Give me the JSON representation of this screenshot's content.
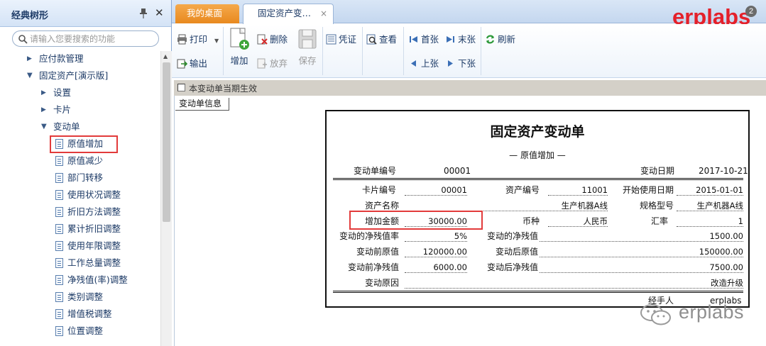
{
  "sidebar": {
    "title": "经典树形",
    "search_placeholder": "请输入您要搜索的功能",
    "items": [
      {
        "label": "应付款管理",
        "indent": 1,
        "arrow": "right"
      },
      {
        "label": "固定资产[演示版]",
        "indent": 1,
        "arrow": "down"
      },
      {
        "label": "设置",
        "indent": 2,
        "arrow": "right"
      },
      {
        "label": "卡片",
        "indent": 2,
        "arrow": "right"
      },
      {
        "label": "变动单",
        "indent": 2,
        "arrow": "down"
      },
      {
        "label": "原值增加",
        "indent": 3,
        "selected": true
      },
      {
        "label": "原值减少",
        "indent": 3
      },
      {
        "label": "部门转移",
        "indent": 3
      },
      {
        "label": "使用状况调整",
        "indent": 3
      },
      {
        "label": "折旧方法调整",
        "indent": 3
      },
      {
        "label": "累计折旧调整",
        "indent": 3
      },
      {
        "label": "使用年限调整",
        "indent": 3
      },
      {
        "label": "工作总量调整",
        "indent": 3
      },
      {
        "label": "净残值(率)调整",
        "indent": 3
      },
      {
        "label": "类别调整",
        "indent": 3
      },
      {
        "label": "增值税调整",
        "indent": 3
      },
      {
        "label": "位置调整",
        "indent": 3
      }
    ]
  },
  "tabs": {
    "desktop": "我的桌面",
    "asset": "固定资产变…",
    "close": "×"
  },
  "brand": {
    "logo": "erplabs",
    "badge": "2",
    "color": "#e4202a"
  },
  "toolbar": {
    "print": "打印",
    "export": "输出",
    "add": "增加",
    "delete": "删除",
    "discard": "放弃",
    "save": "保存",
    "voucher": "凭证",
    "view": "查看",
    "first": "首张",
    "last": "末张",
    "prev": "上张",
    "next": "下张",
    "refresh": "刷新"
  },
  "option_bar": {
    "effective_label": "本变动单当期生效"
  },
  "info_tab": "变动单信息",
  "voucher": {
    "title": "固定资产变动单",
    "subtitle": "— 原值增加 —",
    "change_no_label": "变动单编号",
    "change_no": "00001",
    "change_date_label": "变动日期",
    "change_date": "2017-10-21",
    "card_no_label": "卡片编号",
    "card_no": "00001",
    "asset_no_label": "资产编号",
    "asset_no": "11001",
    "start_date_label": "开始使用日期",
    "start_date": "2015-01-01",
    "asset_name_label": "资产名称",
    "asset_name": "生产机器A线",
    "model_label": "规格型号",
    "model": "生产机器A线",
    "amount_label": "增加金额",
    "amount": "30000.00",
    "currency_label": "币种",
    "currency": "人民币",
    "rate_label": "汇率",
    "rate": "1",
    "net_residual_rate_label": "变动的净残值率",
    "net_residual_rate": "5%",
    "net_residual_label": "变动的净残值",
    "net_residual": "1500.00",
    "orig_before_label": "变动前原值",
    "orig_before": "120000.00",
    "orig_after_label": "变动后原值",
    "orig_after": "150000.00",
    "net_before_label": "变动前净残值",
    "net_before": "6000.00",
    "net_after_label": "变动后净残值",
    "net_after": "7500.00",
    "reason_label": "变动原因",
    "reason": "改造升级",
    "handler_label": "经手人",
    "handler": "erplabs"
  },
  "watermark": {
    "text": "erplabs"
  }
}
